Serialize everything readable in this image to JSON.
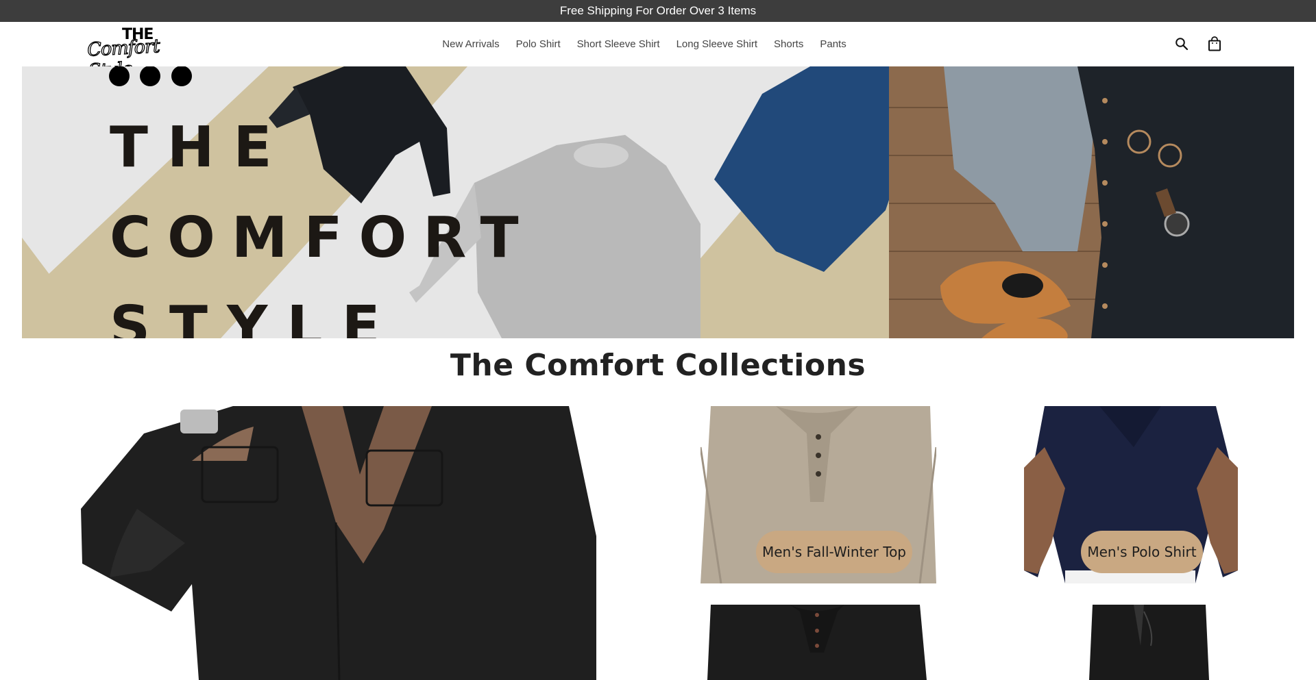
{
  "announcement": {
    "text": "Free Shipping For Order Over 3 Items"
  },
  "header": {
    "logo": {
      "top": "THE",
      "script": "Comfort Style"
    },
    "nav": [
      {
        "label": "New Arrivals"
      },
      {
        "label": "Polo Shirt"
      },
      {
        "label": "Short Sleeve Shirt"
      },
      {
        "label": "Long Sleeve Shirt"
      },
      {
        "label": "Shorts"
      },
      {
        "label": "Pants"
      }
    ],
    "icons": {
      "search": "search-icon",
      "cart": "shopping-bag-icon"
    }
  },
  "hero": {
    "line1": "THE",
    "line2": "COMFORT",
    "line3": "STYLE"
  },
  "collections": {
    "title": "The Comfort Collections",
    "cards": [
      {
        "label": ""
      },
      {
        "label": "Men's Fall-Winter Top"
      },
      {
        "label": "Men's Polo Shirt"
      },
      {
        "label": ""
      },
      {
        "label": ""
      }
    ]
  },
  "colors": {
    "announcement_bg": "#3d3d3d",
    "pill_bg": "#c9a882",
    "hero_stripe": "#cfc29f"
  }
}
